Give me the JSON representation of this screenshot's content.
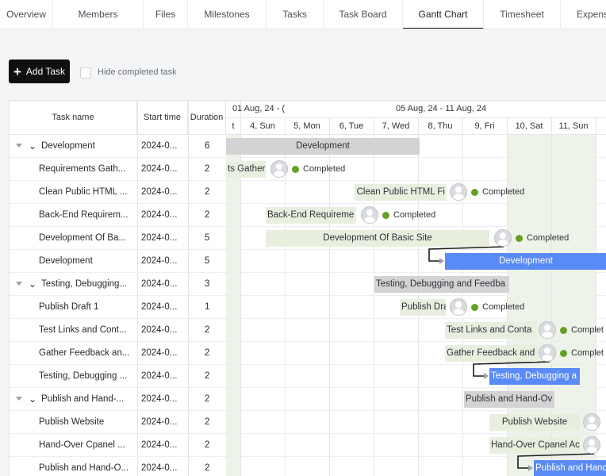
{
  "tabs": [
    {
      "label": "Overview"
    },
    {
      "label": "Members"
    },
    {
      "label": "Files"
    },
    {
      "label": "Milestones"
    },
    {
      "label": "Tasks"
    },
    {
      "label": "Task Board"
    },
    {
      "label": "Gantt Chart"
    },
    {
      "label": "Timesheet"
    },
    {
      "label": "Expens"
    }
  ],
  "active_tab": "Gantt Chart",
  "toolbar": {
    "add_task_label": "Add Task",
    "hide_completed_label": "Hide completed task",
    "hide_completed_checked": false
  },
  "columns": {
    "task_name": "Task name",
    "start_time": "Start time",
    "duration": "Duration"
  },
  "timeline": {
    "week_label_1": "01 Aug, 24 - (",
    "week_label_2": "05 Aug, 24 - 11 Aug, 24",
    "days": [
      "t",
      "4, Sun",
      "5, Mon",
      "6, Tue",
      "7, Wed",
      "8, Thu",
      "9, Fri",
      "10, Sat",
      "11, Sun"
    ]
  },
  "rows": [
    {
      "name": "Development",
      "start": "2024-0...",
      "duration": "6",
      "group": true
    },
    {
      "name": "Requirements Gath...",
      "start": "2024-0...",
      "duration": "2"
    },
    {
      "name": "Clean Public HTML ...",
      "start": "2024-0...",
      "duration": "2"
    },
    {
      "name": "Back-End Requirem...",
      "start": "2024-0...",
      "duration": "2"
    },
    {
      "name": "Development Of Ba...",
      "start": "2024-0...",
      "duration": "5"
    },
    {
      "name": "Development",
      "start": "2024-0...",
      "duration": "5"
    },
    {
      "name": "Testing, Debugging...",
      "start": "2024-0...",
      "duration": "3",
      "group": true
    },
    {
      "name": "Publish Draft 1",
      "start": "2024-0...",
      "duration": "1"
    },
    {
      "name": "Test Links and Cont...",
      "start": "2024-0...",
      "duration": "2"
    },
    {
      "name": "Gather Feedback an...",
      "start": "2024-0...",
      "duration": "2"
    },
    {
      "name": "Testing, Debugging ...",
      "start": "2024-0...",
      "duration": "2"
    },
    {
      "name": "Publish and Hand-...",
      "start": "2024-0...",
      "duration": "2",
      "group": true
    },
    {
      "name": "Publish Website",
      "start": "2024-0...",
      "duration": "2"
    },
    {
      "name": "Hand-Over Cpanel ...",
      "start": "2024-0...",
      "duration": "2"
    },
    {
      "name": "Publish and Hand-O...",
      "start": "2024-0...",
      "duration": "2"
    }
  ],
  "bars": [
    {
      "label": "Development"
    },
    {
      "label": "ts Gather",
      "status": "Completed"
    },
    {
      "label": "Clean Public HTML Fi",
      "status": "Completed"
    },
    {
      "label": "Back-End Requireme",
      "status": "Completed"
    },
    {
      "label": "Development Of Basic Site",
      "status": "Completed"
    },
    {
      "label": "Development"
    },
    {
      "label": "Testing, Debugging and Feedba"
    },
    {
      "label": "Publish Dra",
      "status": "Completed"
    },
    {
      "label": "Test Links and Conta",
      "status": "Complet"
    },
    {
      "label": "Gather Feedback and",
      "status": "Complet"
    },
    {
      "label": "Testing, Debugging a"
    },
    {
      "label": "Publish and Hand-Ov"
    },
    {
      "label": "Publish Website"
    },
    {
      "label": "Hand-Over Cpanel Ac"
    },
    {
      "label": "Publish and Hand"
    }
  ],
  "colors": {
    "summary_bar": "#d3d3d4",
    "completed_bar": "#e8efdf",
    "active_bar": "#5a8af5",
    "completed_dot": "#63a126"
  }
}
